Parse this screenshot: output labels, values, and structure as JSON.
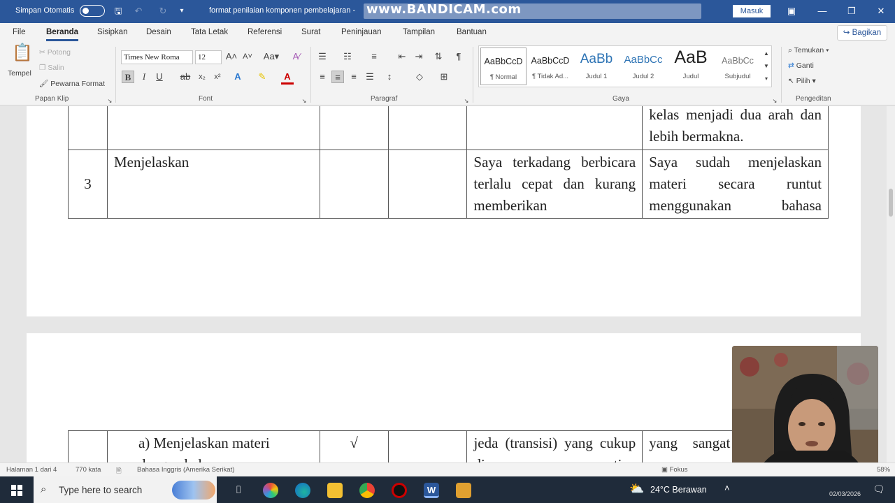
{
  "titlebar": {
    "autosave_label": "Simpan Otomatis",
    "doc_title": "format penilaian komponen pembelajaran -",
    "watermark": "www.BANDICAM.com",
    "signin_label": "Masuk"
  },
  "menu": {
    "tabs": [
      "File",
      "Beranda",
      "Sisipkan",
      "Desain",
      "Tata Letak",
      "Referensi",
      "Surat",
      "Peninjauan",
      "Tampilan",
      "Bantuan"
    ],
    "share_label": "Bagikan"
  },
  "ribbon": {
    "clipboard": {
      "paste": "Tempel",
      "cut": "Potong",
      "copy": "Salin",
      "format_painter": "Pewarna Format",
      "group": "Papan Klip"
    },
    "font": {
      "family": "Times New Roma",
      "size": "12",
      "group": "Font"
    },
    "paragraph": {
      "group": "Paragraf"
    },
    "styles": {
      "items": [
        {
          "preview": "AaBbCcD",
          "name": "¶ Normal"
        },
        {
          "preview": "AaBbCcD",
          "name": "¶ Tidak Ad..."
        },
        {
          "preview": "AaBb",
          "name": "Judul 1"
        },
        {
          "preview": "AaBbCc",
          "name": "Judul 2"
        },
        {
          "preview": "AaB",
          "name": "Judul"
        },
        {
          "preview": "AaBbCc",
          "name": "Subjudul"
        }
      ],
      "group": "Gaya"
    },
    "editing": {
      "find": "Temukan",
      "replace": "Ganti",
      "select": "Pilih",
      "group": "Pengeditan"
    }
  },
  "document": {
    "page1_rows": [
      {
        "no": "",
        "aspect": "",
        "c3": "",
        "c4": "",
        "reflection": "",
        "improvement": "kelas menjadi dua arah dan lebih bermakna."
      },
      {
        "no": "3",
        "aspect": "Menjelaskan",
        "c3": "",
        "c4": "",
        "reflection": "Saya terkadang berbicara terlalu cepat dan kurang memberikan",
        "improvement": "Saya sudah menjelaskan materi secara runtut menggunakan bahasa"
      }
    ],
    "page2_row": {
      "no": "",
      "aspect": "a) Menjelaskan materi dengan bahasa",
      "c3": "√",
      "c4": "",
      "reflection": "jeda (transisi) yang cukup di setiap",
      "improvement": "yang sangat dan mudah"
    }
  },
  "statusbar": {
    "page": "Halaman 1 dari 4",
    "words": "770 kata",
    "language": "Bahasa Inggris (Amerika Serikat)",
    "focus": "Fokus",
    "zoom": "58%"
  },
  "taskbar": {
    "search_placeholder": "Type here to search",
    "weather": "24°C  Berawan",
    "clock_date": "02/03/2026"
  },
  "colors": {
    "titlebar": "#2b579a",
    "taskbar": "#1f2b3a",
    "ribbon": "#f3f3f3"
  }
}
